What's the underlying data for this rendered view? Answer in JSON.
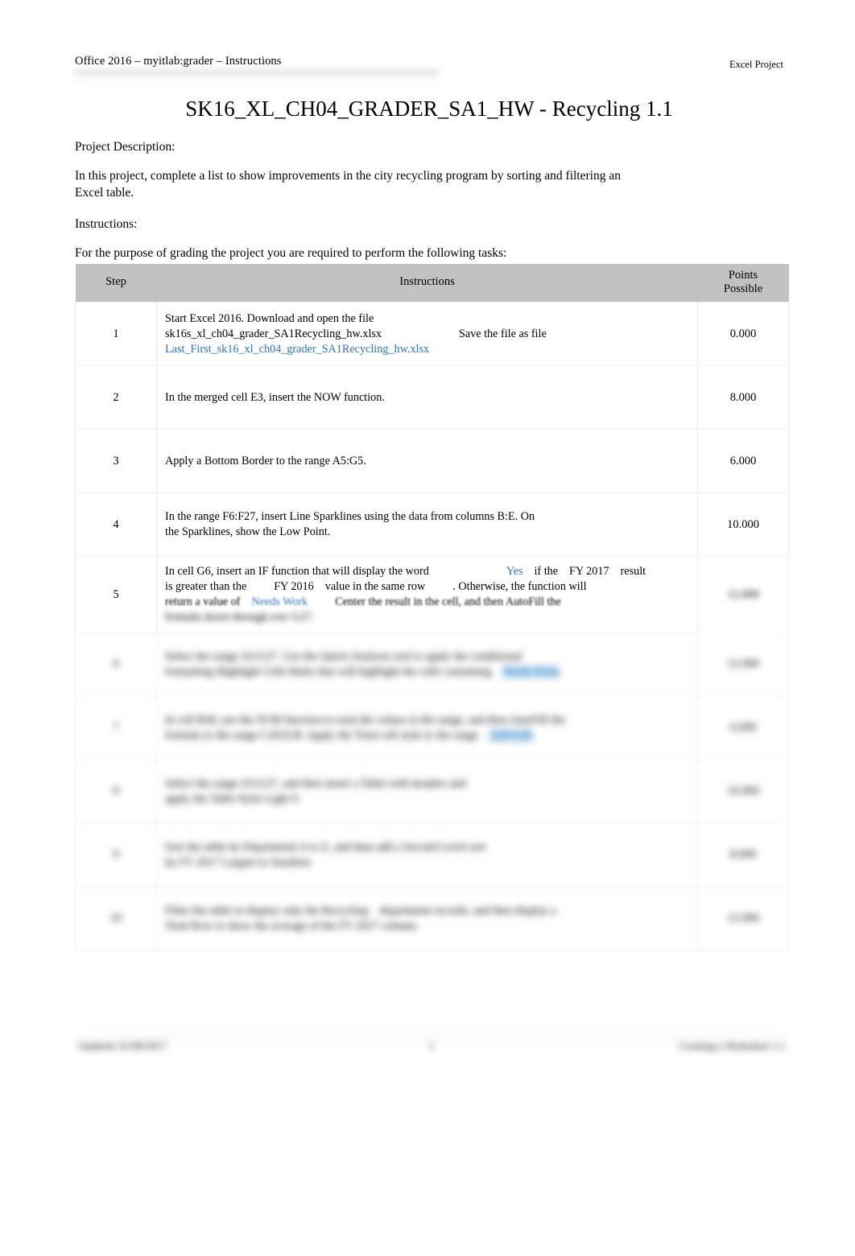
{
  "header": {
    "left": "Office 2016 – myitlab:grader – Instructions",
    "right": "Excel Project"
  },
  "title": "SK16_XL_CH04_GRADER_SA1_HW - Recycling 1.1",
  "body": {
    "description_label": "Project Description:",
    "description_text": "In this project, complete a list to show improvements in the city recycling program by sorting and filtering an Excel table.",
    "instructions_label": "Instructions:",
    "instructions_text": "For the purpose of grading the project you are required to perform the following tasks:"
  },
  "table": {
    "columns": {
      "step": "Step",
      "instructions": "Instructions",
      "points_line1": "Points",
      "points_line2": "Possible"
    },
    "rows": [
      {
        "step": "1",
        "points": "0.000",
        "seg": {
          "a": "Start Excel 2016. Download and open the file",
          "b": "sk16s_xl_ch04_grader_SA1Recycling_hw.xlsx",
          "c": "Save the file as file",
          "d": "Last_First_sk16_xl_ch04_grader_SA1Recycling_hw.xlsx"
        }
      },
      {
        "step": "2",
        "points": "8.000",
        "seg": {
          "a": "In the merged cell E3, insert the NOW function."
        }
      },
      {
        "step": "3",
        "points": "6.000",
        "seg": {
          "a": "Apply a Bottom Border to the range A5:G5."
        }
      },
      {
        "step": "4",
        "points": "10.000",
        "seg": {
          "a": "In the range F6:F27, insert Line Sparklines using the data from columns B:E. On",
          "b": "the Sparklines, show the Low Point."
        }
      },
      {
        "step": "5",
        "points": "12.000",
        "seg": {
          "a": "In cell G6, insert an IF function that will display the word",
          "b": "Yes",
          "c": "if the",
          "d": "FY 2017",
          "e": "result",
          "f": "is greater than the",
          "g": "FY 2016",
          "h": "value in the same row",
          "i": ". Otherwise, the function will",
          "j": "return a value of",
          "k": "Needs Work",
          "l": "Center the result in the cell, and then AutoFill the",
          "m": "formula down through row G27."
        }
      },
      {
        "step": "6",
        "points": "12.000",
        "seg": {
          "a": "Select the range A5:G27. Use the Quick Analysis tool to apply the conditional",
          "b": "formatting Highlight Cells Rules that will highlight the cells containing",
          "c": "Needs Work",
          "d": "."
        }
      },
      {
        "step": "7",
        "points": "6.000",
        "seg": {
          "a": "In cell B28, use the SUM function to total the values in the range, and then AutoFill the",
          "b": "formula to the range C28:E28. Apply the Total cell style to the range",
          "c": "A28:G28",
          "d": "."
        }
      },
      {
        "step": "8",
        "points": "10.000",
        "seg": {
          "a": "Select the range A5:G27",
          "b": ", and then insert a Table with headers and",
          "c": "apply the Table Style Light 9."
        }
      },
      {
        "step": "9",
        "points": "8.000",
        "seg": {
          "a": "Sort the table by Department A to Z",
          "b": ", and then add a Second Level sort",
          "c": "by FY 2017 Largest to Smallest."
        }
      },
      {
        "step": "10",
        "points": "12.000",
        "seg": {
          "a": "Filter the table to display only the Recycling",
          "b": "department records, and then display a",
          "c": "Total Row to show the average of the FY 2017 column."
        }
      }
    ]
  },
  "footer": {
    "left": "Updated: 01/08/2017",
    "center": "1",
    "right": "Creating a Worksheet 1.1"
  }
}
